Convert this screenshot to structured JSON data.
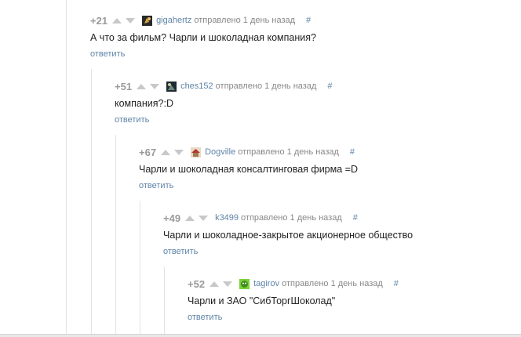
{
  "comments": [
    {
      "score": "+21",
      "author": "gigahertz",
      "sent": "отправлено 1 день назад",
      "hash": "#",
      "text": "А что за фильм? Чарли и шоколадная компания?",
      "reply": "ответить",
      "avatar_icon": "avatar-dark-icon"
    },
    {
      "score": "+51",
      "author": "ches152",
      "sent": "отправлено 1 день назад",
      "hash": "#",
      "text": "компания?:D",
      "reply": "ответить",
      "avatar_icon": "avatar-dark-icon"
    },
    {
      "score": "+67",
      "author": "Dogville",
      "sent": "отправлено 1 день назад",
      "hash": "#",
      "text": "Чарли и шоколадная консалтинговая фирма =D",
      "reply": "ответить",
      "avatar_icon": "avatar-house-icon"
    },
    {
      "score": "+49",
      "author": "k3499",
      "sent": "отправлено 1 день назад",
      "hash": "#",
      "text": "Чарли и шоколадное-закрытое акционерное общество",
      "reply": "ответить",
      "avatar_icon": ""
    },
    {
      "score": "+52",
      "author": "tagirov",
      "sent": "отправлено 1 день назад",
      "hash": "#",
      "text": "Чарли и ЗАО \"СибТоргШоколад\"",
      "reply": "ответить",
      "avatar_icon": "avatar-green-icon"
    }
  ],
  "colors": {
    "link": "#5f84a8",
    "score": "#9a9a9a",
    "text": "#222222",
    "meta": "#888888"
  }
}
